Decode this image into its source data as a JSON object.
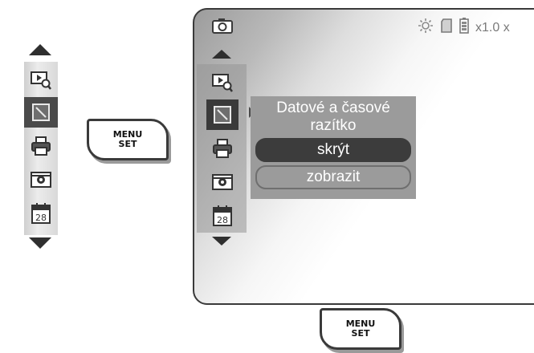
{
  "left_menu": {
    "items": [
      {
        "icon": "playback-zoom-icon",
        "selected": false
      },
      {
        "icon": "timestamp-icon",
        "selected": true
      },
      {
        "icon": "print-icon",
        "selected": false
      },
      {
        "icon": "camera-screen-icon",
        "selected": false
      },
      {
        "icon": "calendar-icon",
        "selected": false,
        "text": "28"
      }
    ]
  },
  "menu_key": {
    "line1": "MENU",
    "line2": "SET"
  },
  "screen": {
    "status": {
      "zoom": "x1.0 x"
    },
    "menu": {
      "items": [
        {
          "icon": "playback-zoom-icon",
          "selected": false
        },
        {
          "icon": "timestamp-icon",
          "selected": true
        },
        {
          "icon": "print-icon",
          "selected": false
        },
        {
          "icon": "camera-screen-icon",
          "selected": false
        },
        {
          "icon": "calendar-icon",
          "selected": false,
          "text": "28"
        }
      ]
    },
    "popup": {
      "title_line1": "Datové a časové",
      "title_line2": "razítko",
      "options": [
        {
          "label": "skrýt",
          "selected": true
        },
        {
          "label": "zobrazit",
          "selected": false
        }
      ]
    }
  },
  "colors": {
    "selected": "#3c3c3c",
    "popup": "#9b9b9b",
    "border": "#3a3a3a"
  }
}
